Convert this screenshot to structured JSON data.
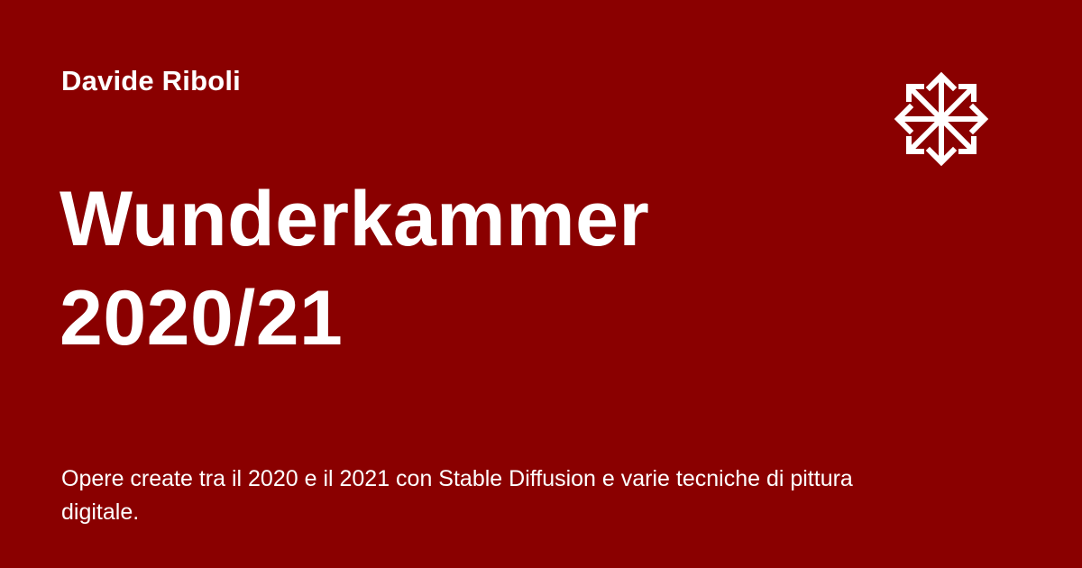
{
  "author": "Davide Riboli",
  "title": {
    "line1": "Wunderkammer",
    "line2": "2020/21"
  },
  "description": "Opere create tra il 2020 e il 2021 con Stable Diffusion e varie tecniche di pittura digitale.",
  "logo_icon": "eight-arrow-star-icon",
  "colors": {
    "background": "#8a0000",
    "text": "#ffffff"
  }
}
